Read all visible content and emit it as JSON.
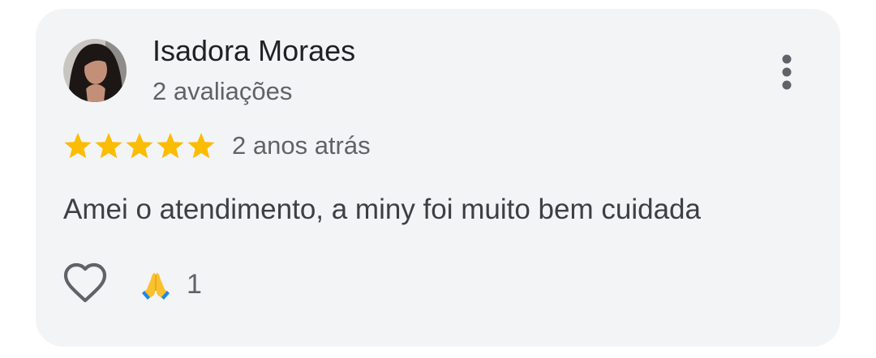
{
  "review": {
    "author_name": "Isadora Moraes",
    "author_review_count": "2 avaliações",
    "rating": 5,
    "rating_max": 5,
    "date": "2 anos atrás",
    "text": "Amei o atendimento, a miny foi muito bem cuidada",
    "reactions": [
      {
        "emoji_icon": "praying-hands-icon",
        "count": "1"
      }
    ]
  },
  "colors": {
    "card_background": "#f3f4f6",
    "star": "#fbbc04",
    "primary_text": "#202124",
    "secondary_text": "#5f6368",
    "body_text": "#3c4043"
  }
}
